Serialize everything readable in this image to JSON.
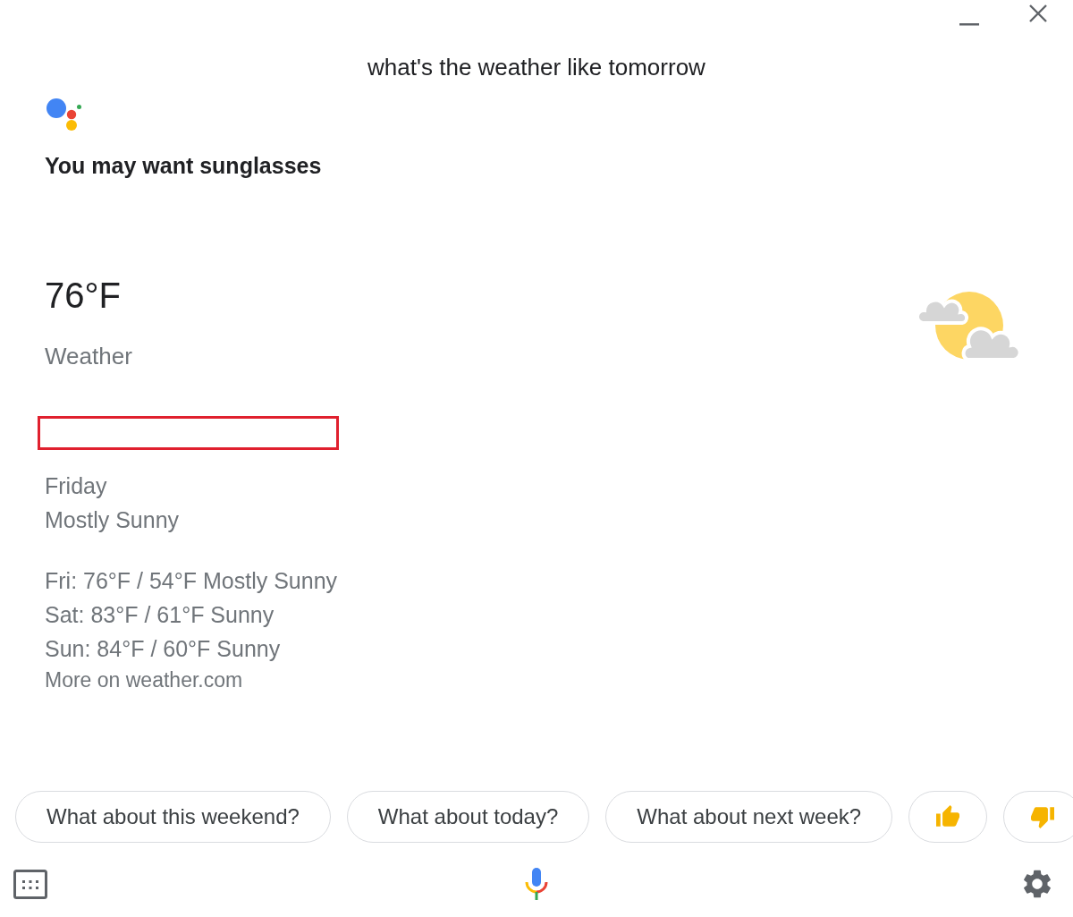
{
  "query": "what's the weather like tomorrow",
  "response": {
    "title": "You may want sunglasses"
  },
  "weather": {
    "temperature": "76°F",
    "label": "Weather",
    "day": "Friday",
    "condition": "Mostly Sunny",
    "forecast": [
      "Fri: 76°F / 54°F Mostly Sunny",
      "Sat: 83°F / 61°F Sunny",
      "Sun: 84°F / 60°F Sunny"
    ],
    "link": "More on weather.com"
  },
  "suggestions": [
    {
      "kind": "text",
      "label": "What about this weekend?"
    },
    {
      "kind": "text",
      "label": "What about today?"
    },
    {
      "kind": "text",
      "label": "What about next week?"
    },
    {
      "kind": "thumbs-up"
    },
    {
      "kind": "thumbs-down"
    }
  ]
}
